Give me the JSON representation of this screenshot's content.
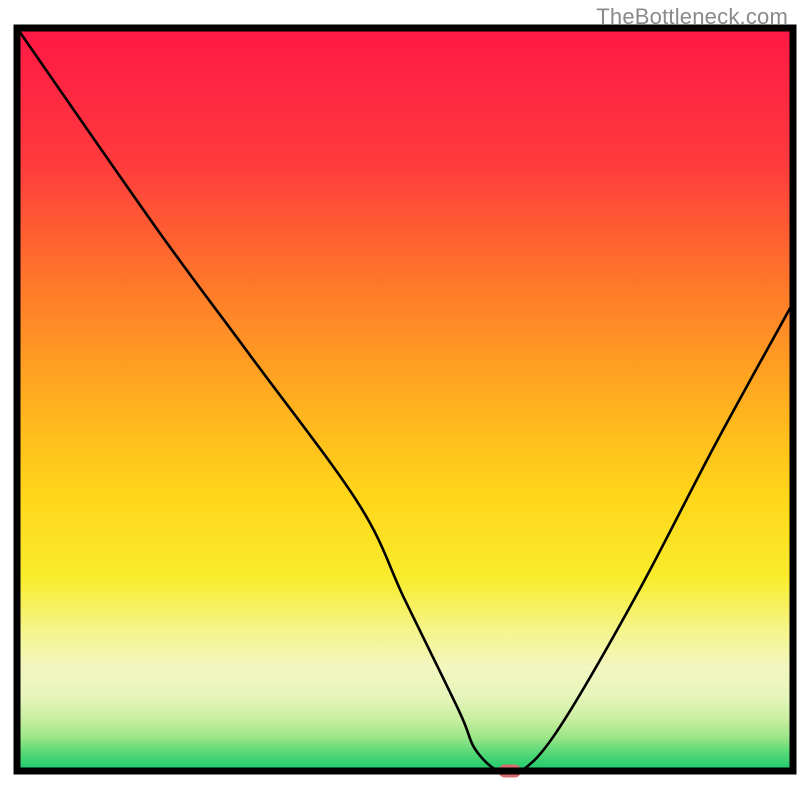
{
  "watermark": "TheBottleneck.com",
  "chart_data": {
    "type": "line",
    "title": "",
    "xlabel": "",
    "ylabel": "",
    "xlim": [
      0,
      100
    ],
    "ylim": [
      0,
      100
    ],
    "grid": false,
    "series": [
      {
        "name": "bottleneck-curve",
        "x": [
          0,
          18,
          30,
          44,
          50,
          57,
          59,
          62,
          65,
          70,
          80,
          90,
          100
        ],
        "values": [
          100,
          73,
          56,
          36,
          23,
          8,
          3,
          0,
          0,
          6,
          24,
          44,
          63
        ]
      }
    ],
    "marker": {
      "x": 63.5,
      "y": 0,
      "color": "#d86b6b"
    },
    "gradient_stops": [
      {
        "pct": 0,
        "color": "#ff1846"
      },
      {
        "pct": 18,
        "color": "#ff3a3d"
      },
      {
        "pct": 35,
        "color": "#ff7a2a"
      },
      {
        "pct": 52,
        "color": "#ffb51e"
      },
      {
        "pct": 63,
        "color": "#ffd61a"
      },
      {
        "pct": 74,
        "color": "#f9ec2b"
      },
      {
        "pct": 81,
        "color": "#f5f58a"
      },
      {
        "pct": 86,
        "color": "#f3f6c0"
      },
      {
        "pct": 90,
        "color": "#e6f5bb"
      },
      {
        "pct": 93,
        "color": "#c9efa0"
      },
      {
        "pct": 95.5,
        "color": "#9be587"
      },
      {
        "pct": 97.5,
        "color": "#58d877"
      },
      {
        "pct": 100,
        "color": "#18c96c"
      }
    ]
  }
}
